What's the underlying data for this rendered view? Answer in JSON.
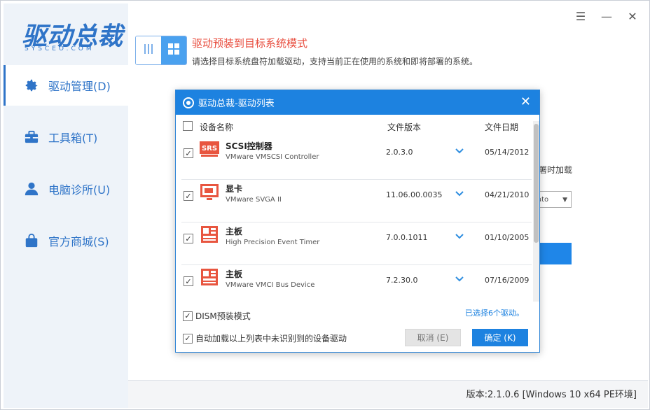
{
  "app": {
    "brand": "驱动总裁",
    "brand_sub": "SYSCEO.COM",
    "window_controls": {
      "menu": "☰",
      "minimize": "—",
      "close": "✕"
    },
    "version": "版本:2.1.0.6 [Windows 10 x64 PE环境]"
  },
  "sidebar": {
    "items": [
      {
        "label": "驱动管理(D)",
        "icon": "gear-icon"
      },
      {
        "label": "工具箱(T)",
        "icon": "toolbox-icon"
      },
      {
        "label": "电脑诊所(U)",
        "icon": "user-icon"
      },
      {
        "label": "官方商城(S)",
        "icon": "shopping-bag-icon"
      }
    ]
  },
  "main": {
    "title": "驱动预装到目标系统模式",
    "description": "请选择目标系统盘符加载驱动，支持当前正在使用的系统和即将部署的系统。",
    "bg_text": "署时加载",
    "bg_select": "ato"
  },
  "dialog": {
    "title": "驱动总裁-驱动列表",
    "headers": {
      "name": "设备名称",
      "version": "文件版本",
      "date": "文件日期"
    },
    "rows": [
      {
        "name": "SCSI控制器",
        "sub": "VMware VMSCSI Controller",
        "version": "2.0.3.0",
        "date": "05/14/2012",
        "icon": "srs-icon"
      },
      {
        "name": "显卡",
        "sub": "VMware SVGA II",
        "version": "11.06.00.0035",
        "date": "04/21/2010",
        "icon": "monitor-icon"
      },
      {
        "name": "主板",
        "sub": "High Precision Event Timer",
        "version": "7.0.0.1011",
        "date": "01/10/2005",
        "icon": "motherboard-icon"
      },
      {
        "name": "主板",
        "sub": "VMware VMCI Bus Device",
        "version": "7.2.30.0",
        "date": "07/16/2009",
        "icon": "motherboard-icon"
      }
    ],
    "dism_label": "DISM预装模式",
    "selected_count": "已选择6个驱动。",
    "autoload_label": "自动加载以上列表中未识别到的设备驱动",
    "cancel_label": "取消 (E)",
    "ok_label": "确定 (K)"
  },
  "colors": {
    "accent": "#1d82e0",
    "title_red": "#e84c3d",
    "sidebar_bg": "#eef3f9",
    "device_icon": "#e8553f"
  }
}
